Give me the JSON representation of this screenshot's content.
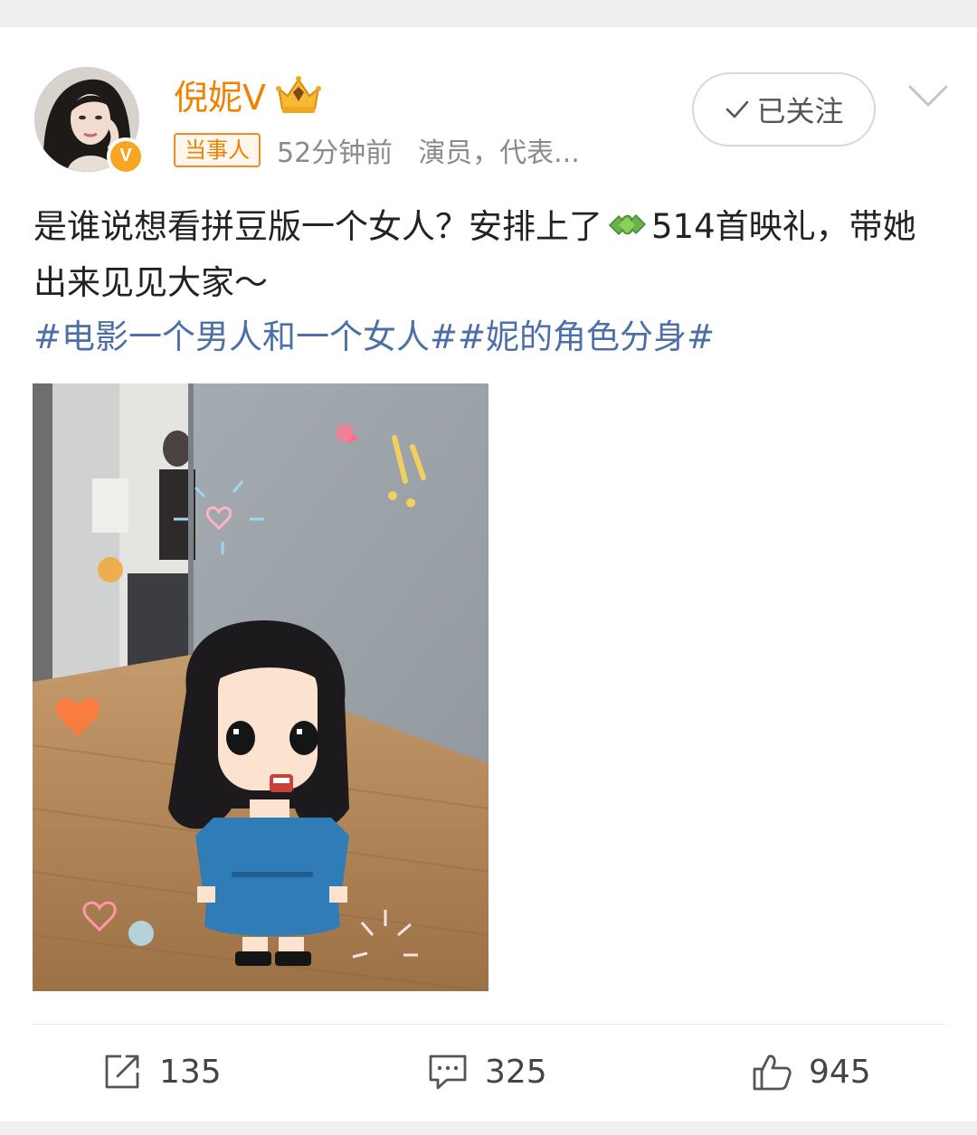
{
  "user": {
    "name": "倪妮V",
    "badge_letter": "V",
    "tag": "当事人",
    "time": "52分钟前",
    "description": "演员，代表..."
  },
  "follow_button": {
    "label": "已关注"
  },
  "post": {
    "text_before_emoji": "是谁说想看拼豆版一个女人？安排上了",
    "text_after_emoji": "514首映礼，带她出来见见大家～",
    "topics": "#电影一个男人和一个女人##妮的角色分身#"
  },
  "actions": {
    "repost_count": "135",
    "comment_count": "325",
    "like_count": "945"
  },
  "colors": {
    "name": "#f08200",
    "topic_link": "#4d6fa8",
    "badge": "#f6a623"
  }
}
